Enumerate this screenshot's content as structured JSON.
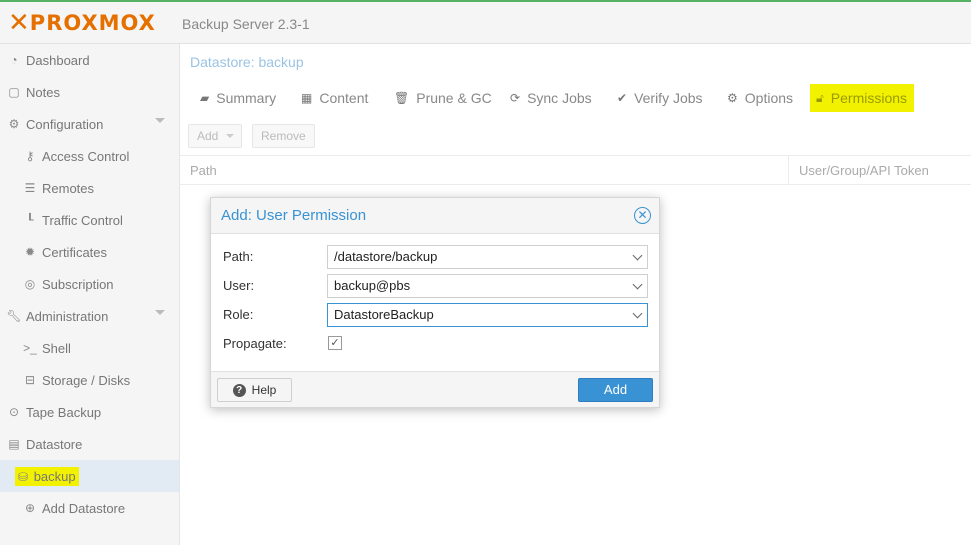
{
  "header": {
    "logo_text": "PROXMOX",
    "version": "Backup Server 2.3-1"
  },
  "sidebar": {
    "items": [
      {
        "label": "Dashboard",
        "icon": "dashboard-icon"
      },
      {
        "label": "Notes",
        "icon": "note-icon"
      },
      {
        "label": "Configuration",
        "icon": "gears-icon"
      },
      {
        "label": "Access Control",
        "icon": "key-icon"
      },
      {
        "label": "Remotes",
        "icon": "server-icon"
      },
      {
        "label": "Traffic Control",
        "icon": "chart-icon"
      },
      {
        "label": "Certificates",
        "icon": "certificate-icon"
      },
      {
        "label": "Subscription",
        "icon": "support-icon"
      },
      {
        "label": "Administration",
        "icon": "wrench-icon"
      },
      {
        "label": "Shell",
        "icon": "terminal-icon"
      },
      {
        "label": "Storage / Disks",
        "icon": "hdd-icon"
      },
      {
        "label": "Tape Backup",
        "icon": "tape-icon"
      },
      {
        "label": "Datastore",
        "icon": "archive-icon"
      },
      {
        "label": "backup",
        "icon": "database-icon"
      },
      {
        "label": "Add Datastore",
        "icon": "plus-circle-icon"
      }
    ]
  },
  "main": {
    "title": "Datastore: backup",
    "tabs": [
      {
        "label": "Summary",
        "icon": "book-icon"
      },
      {
        "label": "Content",
        "icon": "grid-icon"
      },
      {
        "label": "Prune & GC",
        "icon": "trash-icon"
      },
      {
        "label": "Sync Jobs",
        "icon": "refresh-icon"
      },
      {
        "label": "Verify Jobs",
        "icon": "check-circle-icon"
      },
      {
        "label": "Options",
        "icon": "gear-icon"
      },
      {
        "label": "Permissions",
        "icon": "unlock-icon"
      }
    ],
    "toolbar": {
      "add_label": "Add",
      "remove_label": "Remove"
    },
    "columns": [
      "Path",
      "User/Group/API Token"
    ]
  },
  "dialog": {
    "title": "Add: User Permission",
    "fields": {
      "path": {
        "label": "Path:",
        "value": "/datastore/backup"
      },
      "user": {
        "label": "User:",
        "value": "backup@pbs"
      },
      "role": {
        "label": "Role:",
        "value": "DatastoreBackup"
      },
      "propagate": {
        "label": "Propagate:",
        "checked": true
      }
    },
    "help_label": "Help",
    "add_label": "Add"
  },
  "colors": {
    "accent": "#3892d3",
    "brand": "#e57000",
    "highlight": "#f2f200"
  }
}
